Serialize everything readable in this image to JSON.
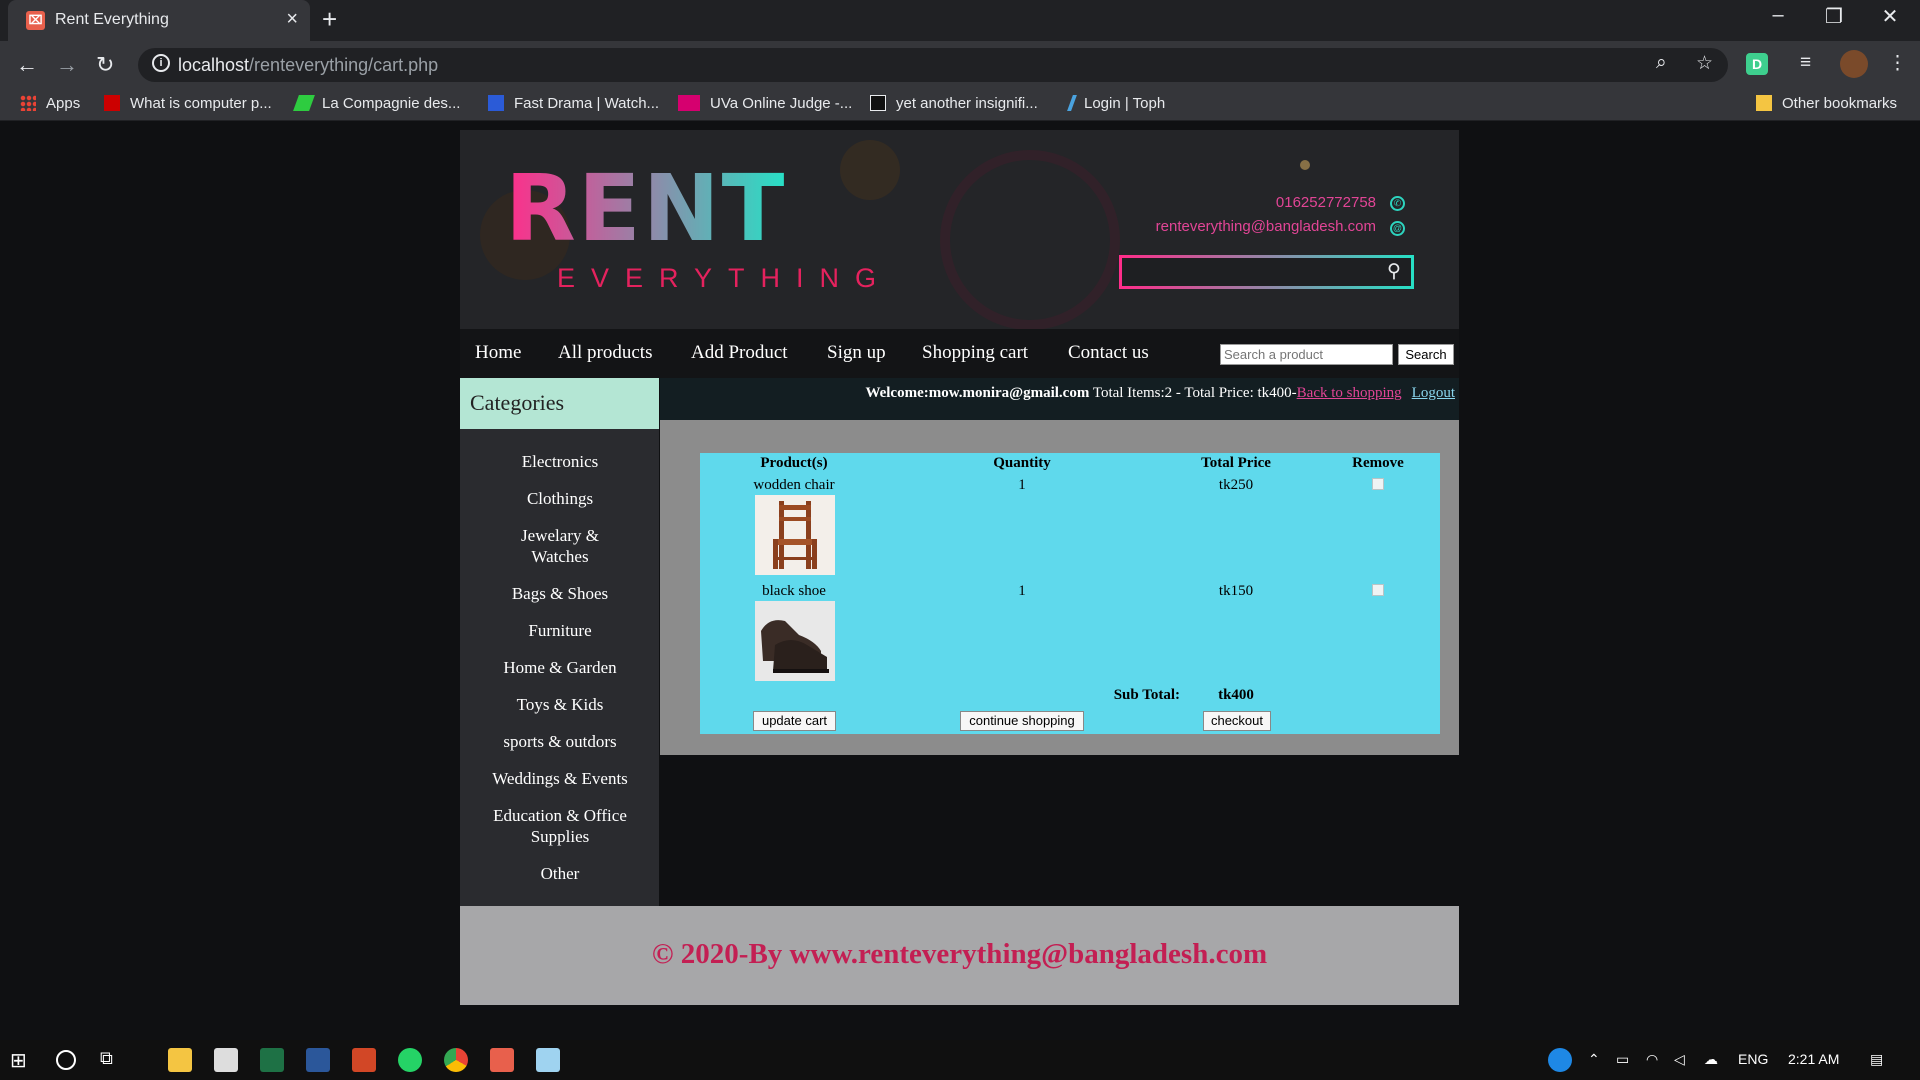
{
  "browser": {
    "tab_title": "Rent Everything",
    "url_host": "localhost",
    "url_path": "/renteverything/cart.php",
    "bookmarks": [
      {
        "label": "Apps"
      },
      {
        "label": "What is computer p..."
      },
      {
        "label": "La Compagnie des..."
      },
      {
        "label": "Fast Drama | Watch..."
      },
      {
        "label": "UVa Online Judge -..."
      },
      {
        "label": "yet another insignifi..."
      },
      {
        "label": "Login | Toph"
      }
    ],
    "other_bookmarks": "Other bookmarks",
    "profile_letter": "D"
  },
  "header": {
    "logo_main": "RENT",
    "logo_sub": "EVERYTHING",
    "phone": "016252772758",
    "email": "renteverything@bangladesh.com"
  },
  "nav": {
    "items": [
      "Home",
      "All products",
      "Add Product",
      "Sign up",
      "Shopping cart",
      "Contact us"
    ],
    "search_placeholder": "Search a product",
    "search_button": "Search"
  },
  "sidebar": {
    "title": "Categories",
    "categories": [
      "Electronics",
      "Clothings",
      "Jewelary &\nWatches",
      "Bags & Shoes",
      "Furniture",
      "Home & Garden",
      "Toys & Kids",
      "sports & outdors",
      "Weddings & Events",
      "Education & Office\nSupplies",
      "Other"
    ]
  },
  "status": {
    "welcome": "Welcome:mow.monira@gmail.com",
    "totals": " Total Items:2 - Total Price: tk400-",
    "back_link": "Back to shopping",
    "logout": "Logout"
  },
  "cart": {
    "headers": [
      "Product(s)",
      "Quantity",
      "Total Price",
      "Remove"
    ],
    "rows": [
      {
        "name": "wodden chair",
        "qty": "1",
        "price": "tk250"
      },
      {
        "name": "black shoe",
        "qty": "1",
        "price": "tk150"
      }
    ],
    "subtotal_label": "Sub Total:",
    "subtotal_value": "tk400",
    "buttons": {
      "update": "update cart",
      "continue": "continue shopping",
      "checkout": "checkout"
    }
  },
  "footer": {
    "copyright": "© 2020-By www.renteverything@bangladesh.com"
  },
  "taskbar": {
    "lang": "ENG",
    "time": "2:21 AM"
  },
  "colors": {
    "accent_pink": "#e24596",
    "cart_bg": "#5fd9ec",
    "footer_text": "#c31f53"
  }
}
